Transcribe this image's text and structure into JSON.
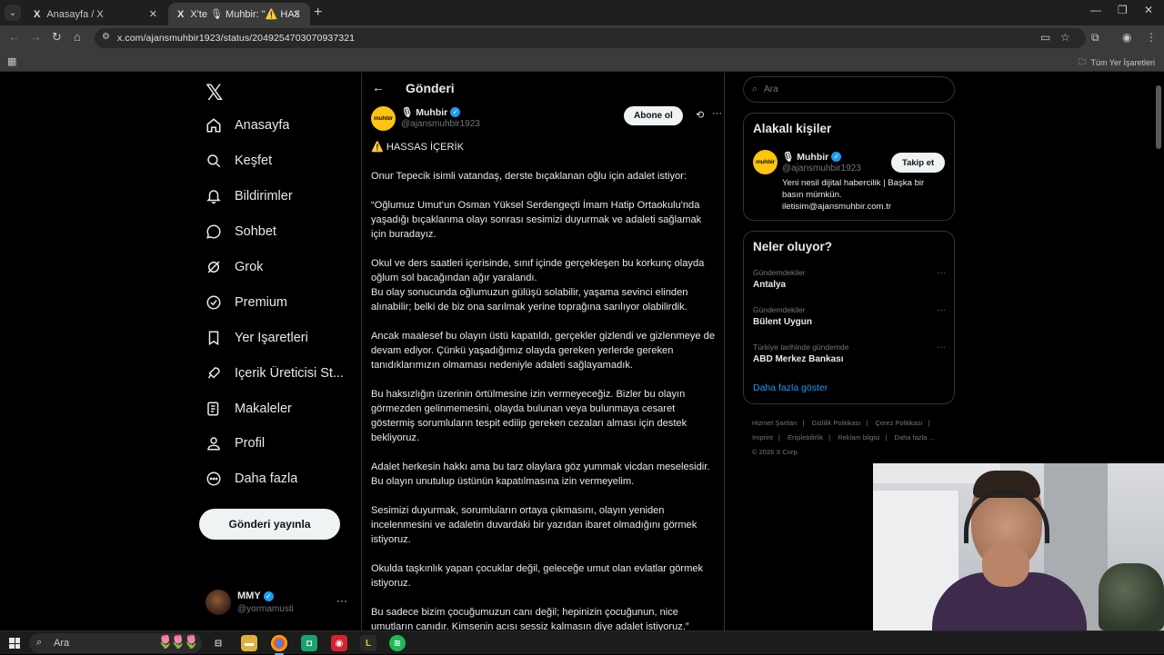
{
  "browser": {
    "tabs": [
      {
        "icon": "X",
        "title": "Anasayfa / X",
        "active": false
      },
      {
        "icon": "X",
        "title": "X'te 🎙 Muhbir: \"⚠️ HASSAS İÇ",
        "active": true
      }
    ],
    "url": "x.com/ajansmuhbir1923/status/2049254703070937321",
    "bookmarks_all": "Tüm Yer İşaretleri"
  },
  "sidebar": {
    "items": [
      {
        "label": "Anasayfa",
        "icon": "home-icon"
      },
      {
        "label": "Keşfet",
        "icon": "search-icon"
      },
      {
        "label": "Bildirimler",
        "icon": "bell-icon"
      },
      {
        "label": "Sohbet",
        "icon": "chat-icon"
      },
      {
        "label": "Grok",
        "icon": "grok-icon"
      },
      {
        "label": "Premium",
        "icon": "verified-icon"
      },
      {
        "label": "Yer İşaretleri",
        "icon": "bookmark-icon"
      },
      {
        "label": "İçerik Üreticisi St...",
        "icon": "rocket-icon"
      },
      {
        "label": "Makaleler",
        "icon": "article-icon"
      },
      {
        "label": "Profil",
        "icon": "profile-icon"
      },
      {
        "label": "Daha fazla",
        "icon": "more-icon"
      }
    ],
    "post_button": "Gönderi yayınla",
    "account": {
      "name": "MMY",
      "handle": "@yormamusti"
    }
  },
  "main": {
    "header_title": "Gönderi",
    "author": {
      "logo_text": "muhbir",
      "name": "🎙 Muhbir",
      "handle": "@ajansmuhbir1923"
    },
    "subscribe_button": "Abone ol",
    "tweet_paragraphs": [
      "⚠️ HASSAS İÇERİK",
      "Onur Tepecik isimli vatandaş, derste bıçaklanan oğlu için adalet istiyor:",
      "“Oğlumuz Umut’un Osman Yüksel Serdengeçti İmam Hatip Ortaokulu'nda yaşadığı bıçaklanma olayı sonrası sesimizi duyurmak ve adaleti sağlamak için buradayız.",
      "Okul ve ders saatleri içerisinde, sınıf içinde gerçekleşen bu korkunç olayda oğlum sol bacağından ağır yaralandı.\nBu olay sonucunda oğlumuzun gülüşü solabilir, yaşama sevinci elinden alınabilir; belki de biz ona sarılmak yerine toprağına sarılıyor olabilirdik.",
      "Ancak maalesef bu olayın üstü kapatıldı, gerçekler gizlendi ve gizlenmeye de devam ediyor. Çünkü yaşadığımız olayda gereken yerlerde gereken tanıdıklarımızın olmaması nedeniyle adaleti sağlayamadık.",
      "Bu haksızlığın üzerinin örtülmesine izin vermeyeceğiz. Bizler bu olayın görmezden gelinmemesini, olayda bulunan veya bulunmaya cesaret göstermiş sorumluların tespit edilip gereken cezaları alması için destek bekliyoruz.",
      "Adalet herkesin hakkı ama bu tarz olaylara göz yummak vicdan meselesidir. Bu olayın unutulup üstünün kapatılmasına izin vermeyelim.",
      "Sesimizi duyurmak, sorumluların ortaya çıkmasını, olayın yeniden incelenmesini ve adaletin duvardaki bir yazıdan ibaret olmadığını görmek istiyoruz.",
      "Okulda taşkınlık yapan çocuklar değil, geleceğe umut olan evlatlar görmek istiyoruz.",
      "Bu sadece bizim çocuğumuzun canı değil; hepinizin çocuğunun, nice umutların canıdır. Kimsenin acısı sessiz kalmasın diye adalet istiyoruz.”"
    ]
  },
  "right": {
    "search_placeholder": "Ara",
    "related_title": "Alakalı kişiler",
    "related_person": {
      "logo_text": "muhbir",
      "name": "🎙 Muhbir",
      "handle": "@ajansmuhbir1923",
      "follow_button": "Takip et",
      "bio": "Yeni nesil dijital habercilik | Başka bir basın mümkün. iletisim@ajansmuhbir.com.tr"
    },
    "trends_title": "Neler oluyor?",
    "trends": [
      {
        "category": "Gündemdekiler",
        "name": "Antalya"
      },
      {
        "category": "Gündemdekiler",
        "name": "Bülent Uygun"
      },
      {
        "category": "Türkiye tarihinde gündemde",
        "name": "ABD Merkez Bankası"
      }
    ],
    "show_more": "Daha fazla göster",
    "footer_links": [
      "Hizmet Şartları",
      "|",
      "Gizlilik Politikası",
      "|",
      "Çerez Politikası",
      "|",
      "Imprint",
      "|",
      "Erişilebilirlik",
      "|",
      "Reklam bilgisi",
      "|",
      "Daha fazla ...",
      "© 2026 X Corp."
    ]
  },
  "taskbar": {
    "search_placeholder": "Ara",
    "apps": [
      "task-view",
      "file-explorer",
      "chrome",
      "app-green",
      "app-red",
      "app-yellow",
      "spotify"
    ]
  }
}
